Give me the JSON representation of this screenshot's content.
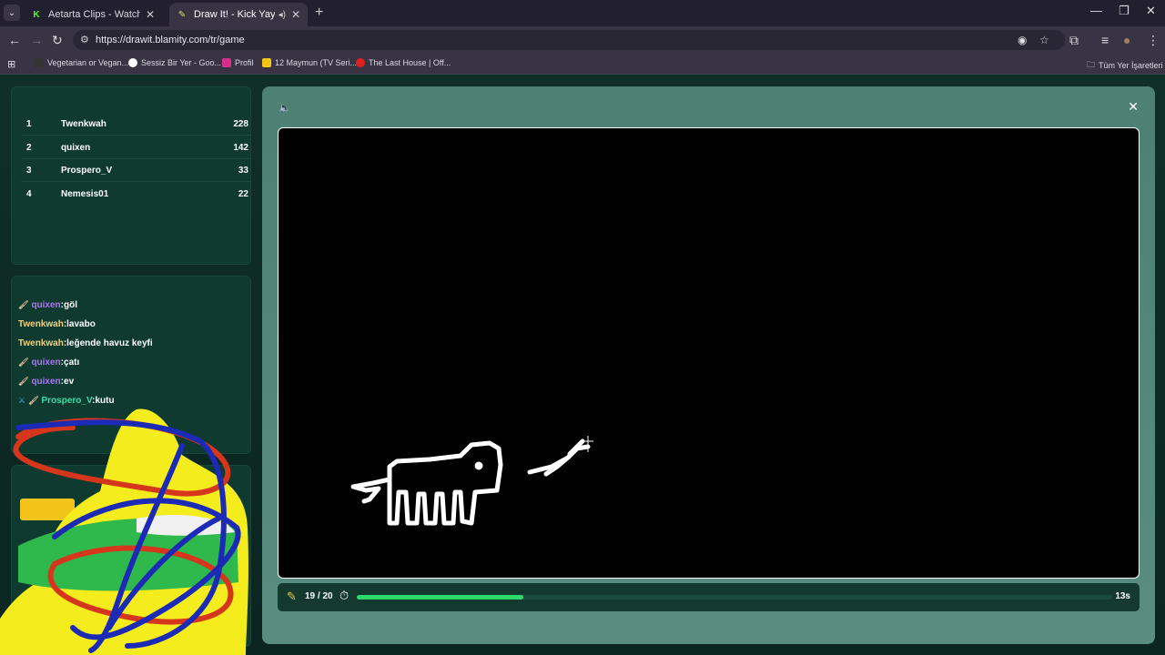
{
  "browser": {
    "tabs": [
      {
        "title": "Aetarta Clips - Watch Live on Ki",
        "favicon": "K",
        "active": false
      },
      {
        "title": "Draw It! - Kick Yayınları İçin",
        "favicon": "✎",
        "active": true
      }
    ],
    "url": "https://drawit.blamity.com/tr/game",
    "bookmarks": [
      "Vegetarian or Vegan...",
      "Sessiz Bir Yer - Goo...",
      "Profil",
      "12 Maymun (TV Seri...",
      "The Last House | Off..."
    ],
    "all_bookmarks": "Tüm Yer İşaretleri"
  },
  "leaderboard": [
    {
      "rank": "1",
      "name": "Twenkwah",
      "score": "228"
    },
    {
      "rank": "2",
      "name": "quixen",
      "score": "142"
    },
    {
      "rank": "3",
      "name": "Prospero_V",
      "score": "33"
    },
    {
      "rank": "4",
      "name": "Nemesis01",
      "score": "22"
    }
  ],
  "chat": [
    {
      "user": "quixen",
      "message": ":göl",
      "color": "purple",
      "icons": [
        "brush"
      ]
    },
    {
      "user": "Twenkwah",
      "message": ":lavabo",
      "color": "yellow",
      "icons": []
    },
    {
      "user": "Twenkwah",
      "message": ":leğende havuz keyfi",
      "color": "yellow",
      "icons": []
    },
    {
      "user": "quixen",
      "message": ":çatı",
      "color": "purple",
      "icons": [
        "brush"
      ]
    },
    {
      "user": "quixen",
      "message": ":ev",
      "color": "purple",
      "icons": [
        "brush"
      ]
    },
    {
      "user": "Prospero_V",
      "message": ":kutu",
      "color": "green",
      "icons": [
        "sword",
        "brush"
      ]
    }
  ],
  "game": {
    "round": "19 / 20",
    "seconds_left": "13s",
    "progress": 0.22,
    "colors": {
      "accent": "#2bd96b",
      "modal": "#5a8d80",
      "panel": "#0f3a30"
    }
  }
}
